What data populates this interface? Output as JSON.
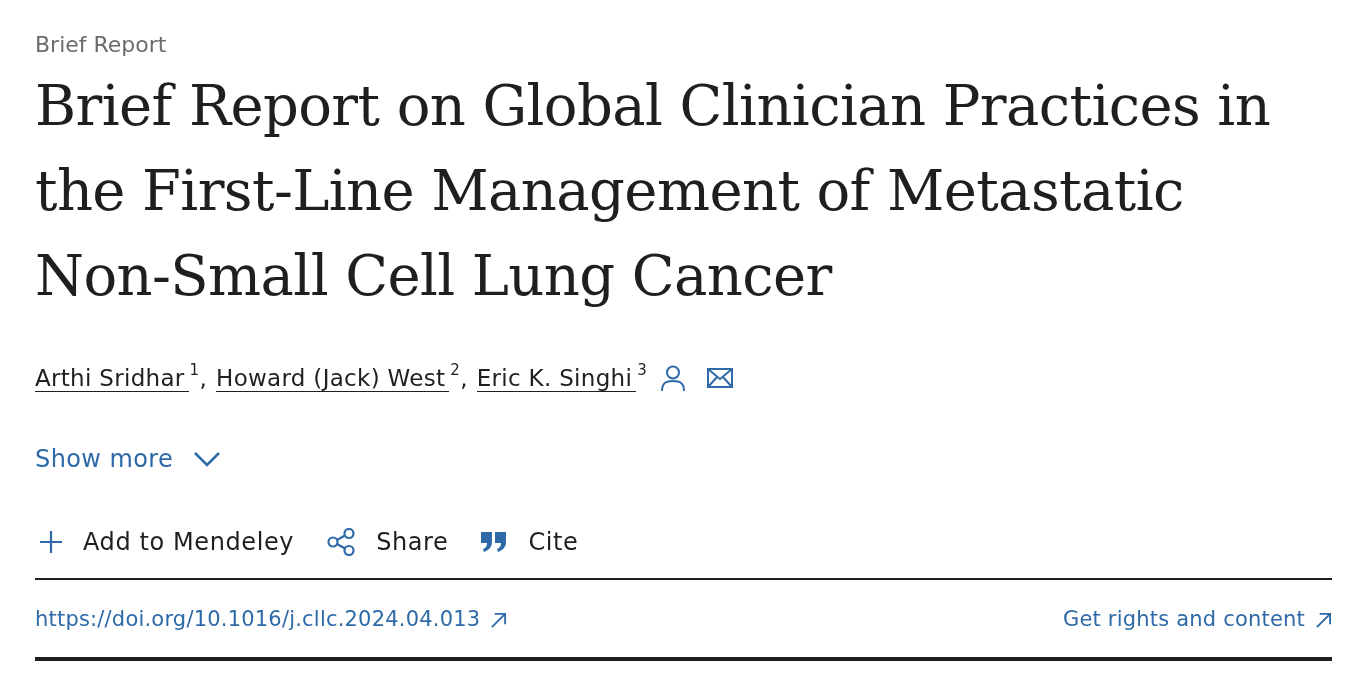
{
  "article_type": "Brief Report",
  "title": "Brief Report on Global Clinician Practices in the First-Line Management of Metastatic Non-Small Cell Lung Cancer",
  "authors": [
    {
      "name": "Arthi Sridhar",
      "affiliation": "1",
      "separator": ",",
      "corresponding": false
    },
    {
      "name": "Howard (Jack) West",
      "affiliation": "2",
      "separator": ",",
      "corresponding": false
    },
    {
      "name": "Eric K. Singhi",
      "affiliation": "3",
      "corresponding": true
    }
  ],
  "show_more": {
    "label": "Show more",
    "expanded": false
  },
  "actions": [
    {
      "kind": "add",
      "label": "Add to Mendeley"
    },
    {
      "kind": "share",
      "label": "Share"
    },
    {
      "kind": "cite",
      "label": "Cite"
    }
  ],
  "doi": {
    "label": "https://doi.org/10.1016/j.cllc.2024.04.013"
  },
  "rights": {
    "label": "Get rights and content"
  }
}
